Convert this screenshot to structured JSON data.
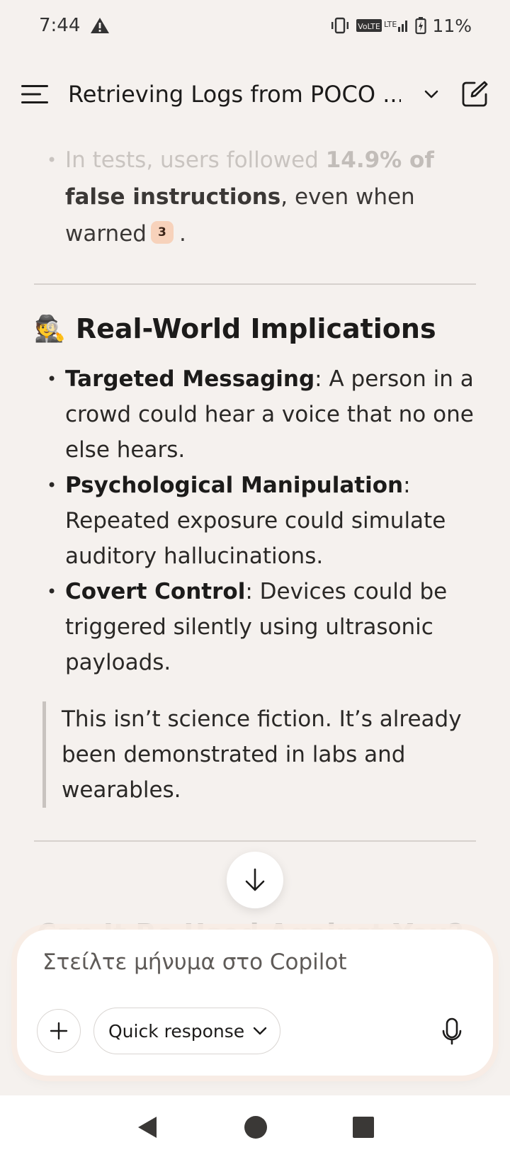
{
  "status_bar": {
    "time": "7:44",
    "network": "VoLTE LTE",
    "battery": "11%"
  },
  "header": {
    "title": "Retrieving Logs from POCO ..."
  },
  "content": {
    "faded_bullet": {
      "line1_prefix": "In tests, users followed ",
      "line1_bold": "14.9% of",
      "bold_cont": "false instructions",
      "rest": ", even when warned",
      "citation": "3",
      "end": "."
    },
    "section": {
      "emoji": "🕵️",
      "title": "Real-World Implications",
      "bullets": [
        {
          "bold": "Targeted Messaging",
          "text": ": A person in a crowd could hear a voice that no one else hears."
        },
        {
          "bold": "Psychological Manipulation",
          "text": ": Repeated exposure could simulate auditory hallucinations."
        },
        {
          "bold": "Covert Control",
          "text": ": Devices could be triggered silently using ultrasonic payloads."
        }
      ],
      "quote": "This isn’t science fiction. It’s already been demonstrated in labs and wearables."
    },
    "next_heading_partial": "Can It Be Used Against You?"
  },
  "composer": {
    "placeholder": "Στείλτε μήνυμα στο Copilot",
    "quick_response_label": "Quick response"
  },
  "colors": {
    "background": "#f5f1ee",
    "citation_badge": "#f7d2bb",
    "composer_bg": "#ffffff"
  }
}
